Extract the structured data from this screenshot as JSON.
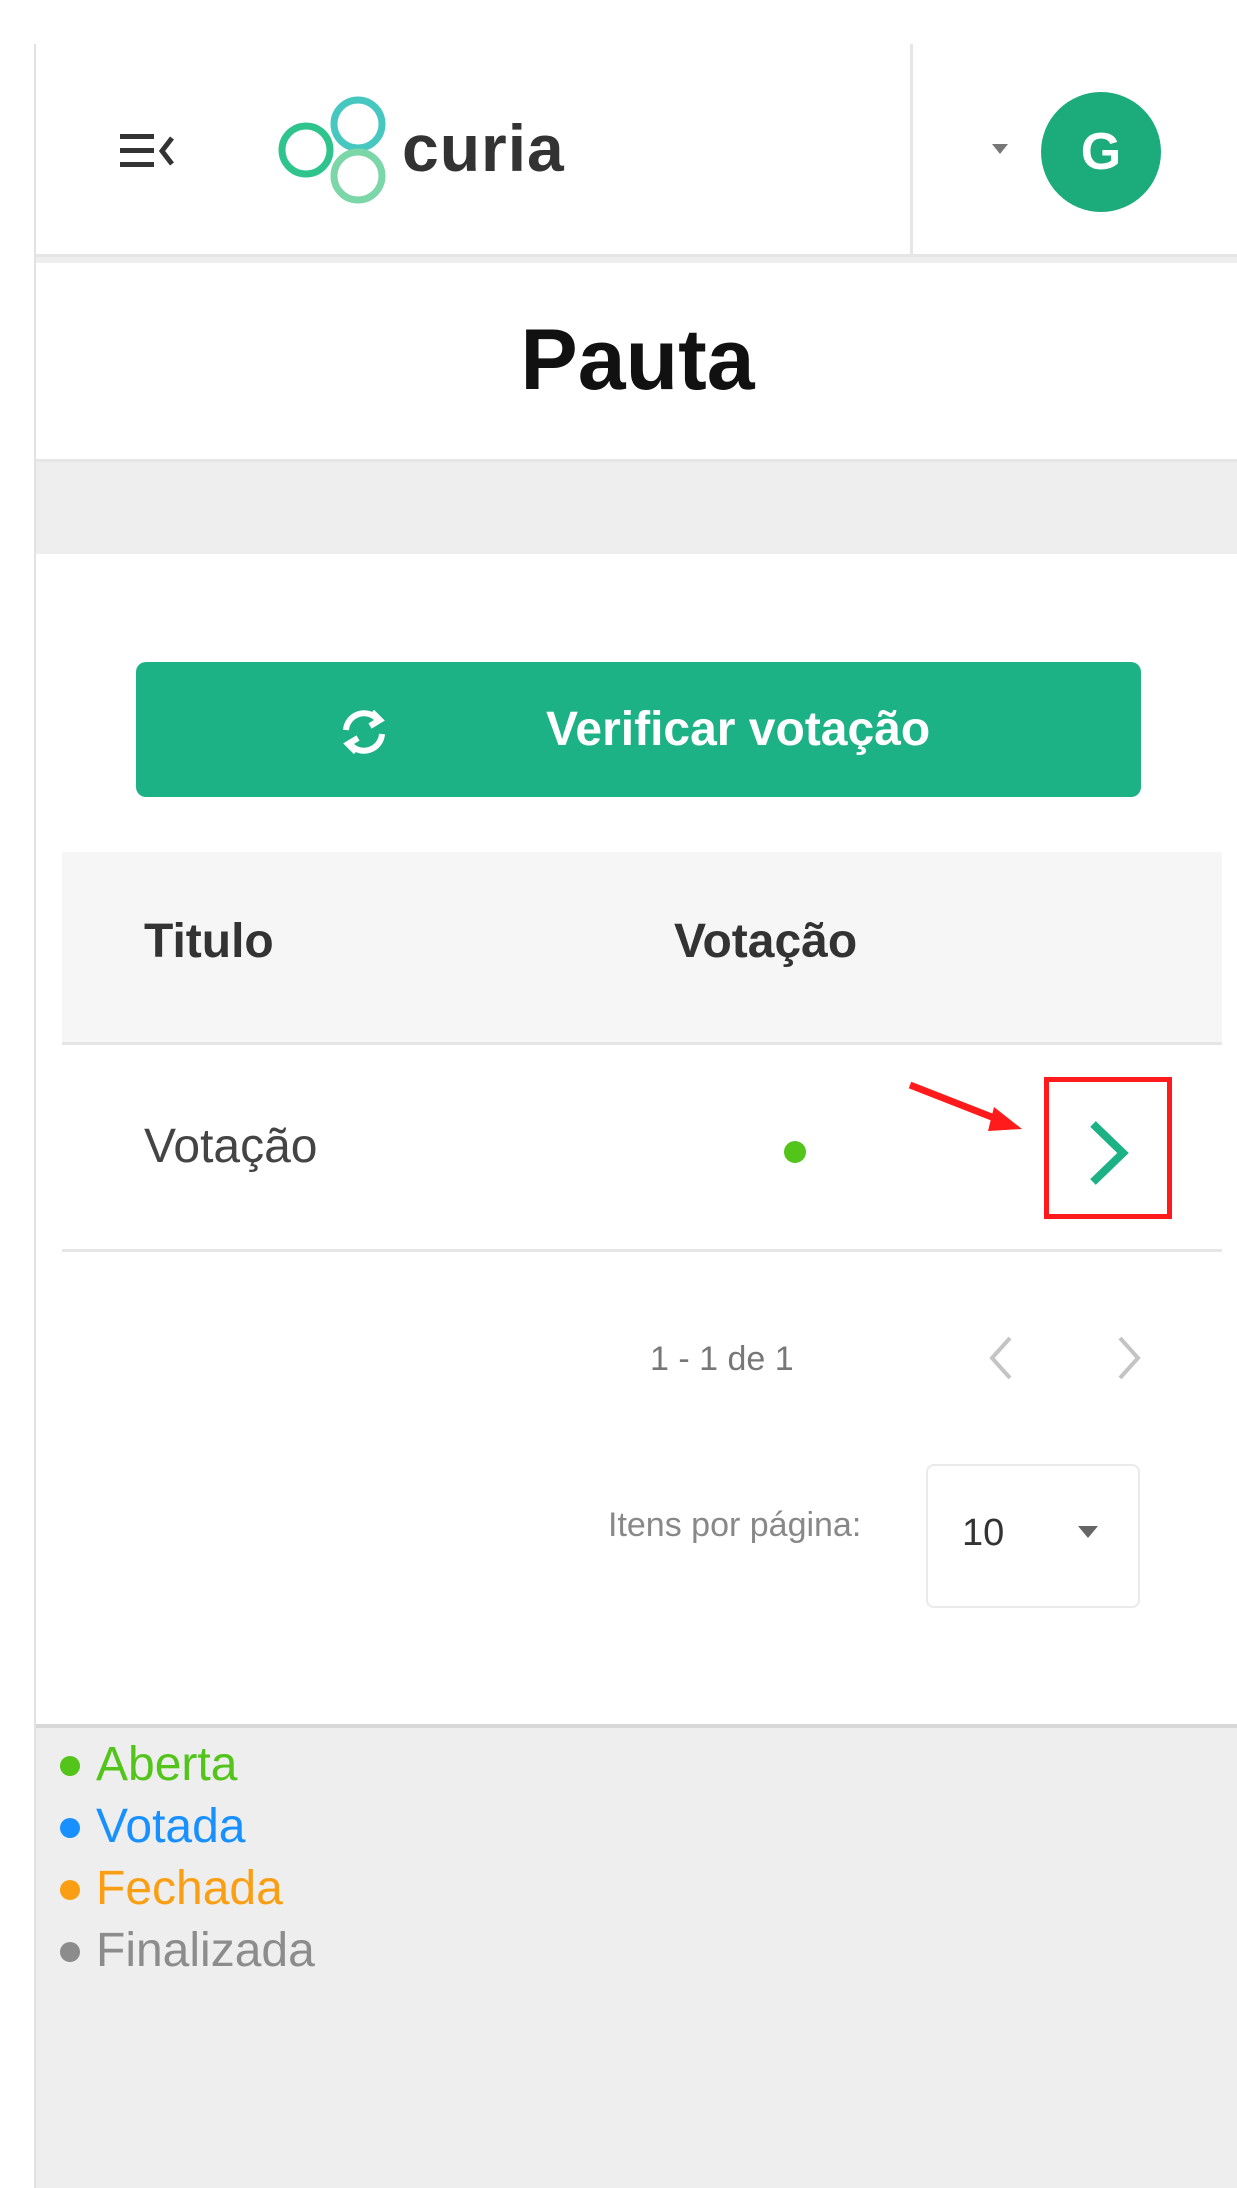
{
  "header": {
    "logo_text": "curia",
    "avatar_initial": "G",
    "brand_color": "#1cac7c"
  },
  "page": {
    "title": "Pauta"
  },
  "actions": {
    "verify_label": "Verificar votação"
  },
  "table": {
    "columns": [
      "Titulo",
      "Votação"
    ],
    "rows": [
      {
        "title": "Votação",
        "status": "Aberta",
        "status_color": "#52c41a"
      }
    ]
  },
  "paginator": {
    "range": "1 - 1 de 1",
    "items_per_page_label": "Itens por página:",
    "page_size": "10"
  },
  "legend": [
    {
      "label": "Aberta",
      "color": "#52c41a"
    },
    {
      "label": "Votada",
      "color": "#1890ff"
    },
    {
      "label": "Fechada",
      "color": "#fa9f14"
    },
    {
      "label": "Finalizada",
      "color": "#8c8c8c"
    }
  ]
}
